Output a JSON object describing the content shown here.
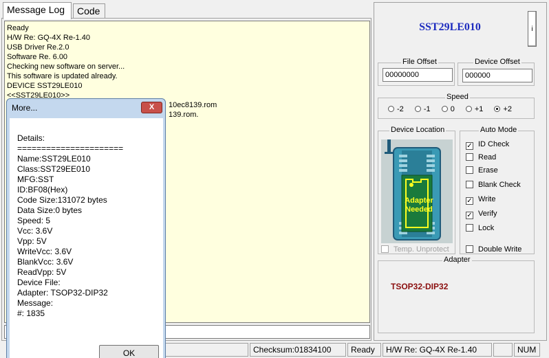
{
  "tabs": [
    {
      "label": "Message Log",
      "active": true
    },
    {
      "label": "Code",
      "active": false
    }
  ],
  "log": {
    "lines": [
      "Ready",
      "H/W Re: GQ-4X Re-1.40",
      "USB Driver Re.2.0",
      "Software Re. 6.00",
      "Checking new software on server...",
      "This software is updated already.",
      "DEVICE SST29LE010",
      "<<SST29LE010>>"
    ],
    "partial_line_1": "10ec8139.rom",
    "partial_line_2": "139.rom."
  },
  "chip": {
    "name": "SST29LE010",
    "info_label": "i"
  },
  "file_offset": {
    "label": "File Offset",
    "value": "00000000"
  },
  "device_offset": {
    "label": "Device Offset",
    "value": "000000"
  },
  "speed": {
    "label": "Speed",
    "options": [
      "-2",
      "-1",
      "0",
      "+1",
      "+2"
    ],
    "selected": "+2"
  },
  "device_location": {
    "label": "Device Location",
    "adapter_text": "Adapter Needed",
    "temp_unprotect": {
      "label": "Temp. Unprotect",
      "checked": false,
      "disabled": true
    }
  },
  "auto_mode": {
    "label": "Auto Mode",
    "items": [
      {
        "label": "ID Check",
        "checked": true
      },
      {
        "label": "Read",
        "checked": false
      },
      {
        "label": "Erase",
        "checked": false
      },
      {
        "label": "Blank Check",
        "checked": false
      },
      {
        "label": "Write",
        "checked": true
      },
      {
        "label": "Verify",
        "checked": true
      },
      {
        "label": "Lock",
        "checked": false
      }
    ],
    "double_write": {
      "label": "Double Write",
      "checked": false
    }
  },
  "adapter": {
    "label": "Adapter",
    "value": "TSOP32-DIP32"
  },
  "status_bar": {
    "checksum": "Checksum:01834100",
    "state": "Ready",
    "hw": "H/W Re: GQ-4X Re-1.40",
    "num": "NUM"
  },
  "dialog": {
    "title": "More...",
    "close_label": "X",
    "ok_label": "OK",
    "lines": [
      "Details:",
      "======================",
      "Name:SST29LE010",
      "Class:SST29EE010",
      "MFG:SST",
      "ID:BF08(Hex)",
      "Code Size:131072 bytes",
      "Data Size:0 bytes",
      "Speed: 5",
      "Vcc: 3.6V",
      "Vpp: 5V",
      "WriteVcc: 3.6V",
      "BlankVcc: 3.6V",
      "ReadVpp: 5V",
      "Device File:",
      "Adapter: TSOP32-DIP32",
      "Message:",
      "#: 1835"
    ]
  },
  "colors": {
    "log_bg": "#ffffdf",
    "chip_name": "#1d2cbf",
    "adapter_name": "#8b0f0f",
    "adapter_board": "#1a7a3c",
    "adapter_text": "#ffff20",
    "dialog_frame": "#c4d8ee",
    "close_button": "#c8504a"
  }
}
